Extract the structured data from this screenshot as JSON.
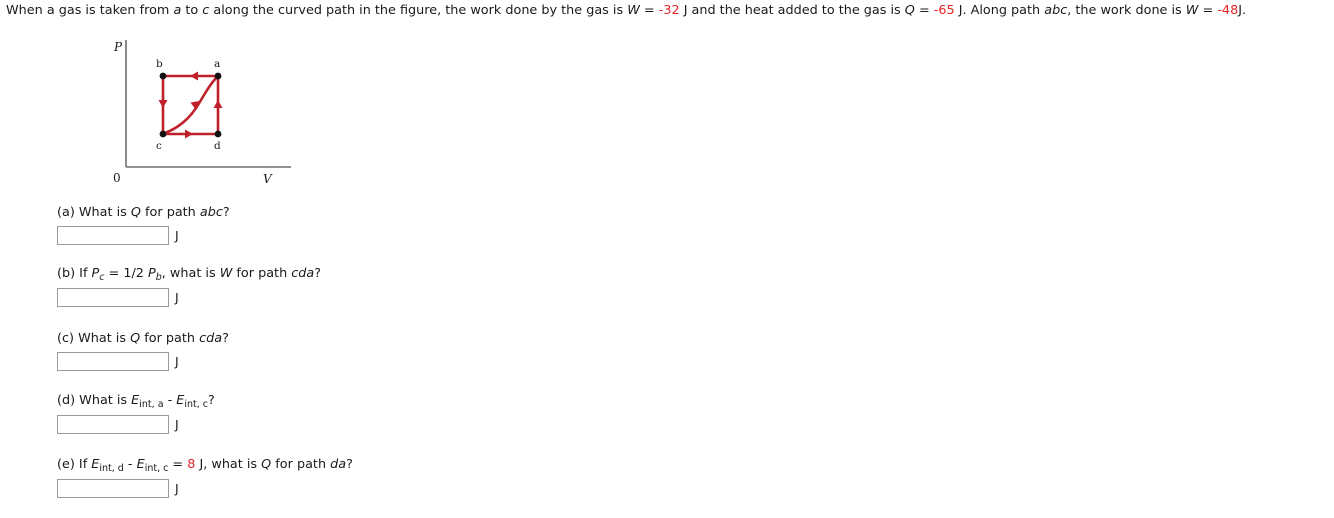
{
  "problem": {
    "text_parts": [
      {
        "t": "When a gas is taken from ",
        "style": "plain"
      },
      {
        "t": "a",
        "style": "italic"
      },
      {
        "t": " to ",
        "style": "plain"
      },
      {
        "t": "c",
        "style": "italic"
      },
      {
        "t": " along the curved path in the figure, the work done by the gas is ",
        "style": "plain"
      },
      {
        "t": "W",
        "style": "italic"
      },
      {
        "t": " = ",
        "style": "plain"
      },
      {
        "t": "-32",
        "style": "red"
      },
      {
        "t": " J and the heat added to the gas is ",
        "style": "plain"
      },
      {
        "t": "Q",
        "style": "italic"
      },
      {
        "t": " = ",
        "style": "plain"
      },
      {
        "t": "-65",
        "style": "red"
      },
      {
        "t": " J. Along path ",
        "style": "plain"
      },
      {
        "t": "abc",
        "style": "italic"
      },
      {
        "t": ", the work done is ",
        "style": "plain"
      },
      {
        "t": "W",
        "style": "italic"
      },
      {
        "t": " = ",
        "style": "plain"
      },
      {
        "t": "-48",
        "style": "red"
      },
      {
        "t": "J.",
        "style": "plain"
      }
    ],
    "work_ac": "-32",
    "heat_ac": "-65",
    "work_abc": "-48"
  },
  "figure": {
    "type": "pv-diagram",
    "y_axis_label": "P",
    "x_axis_label": "V",
    "origin_label": "0",
    "curve_color": "#c0202a",
    "axis_color": "#6e6e6e",
    "points": [
      {
        "label": "b",
        "position": "top-left"
      },
      {
        "label": "a",
        "position": "top-right"
      },
      {
        "label": "c",
        "position": "bottom-left"
      },
      {
        "label": "d",
        "position": "bottom-right"
      }
    ],
    "paths": [
      {
        "from": "a",
        "to": "b",
        "shape": "straight",
        "edge": "top",
        "arrow": "left"
      },
      {
        "from": "b",
        "to": "c",
        "shape": "straight",
        "edge": "left",
        "arrow": "down"
      },
      {
        "from": "c",
        "to": "d",
        "shape": "straight",
        "edge": "bottom",
        "arrow": "right"
      },
      {
        "from": "d",
        "to": "a",
        "shape": "straight",
        "edge": "right",
        "arrow": "up"
      },
      {
        "from": "a",
        "to": "c",
        "shape": "curved",
        "edge": "interior",
        "arrow": "down"
      }
    ]
  },
  "questions": {
    "a": {
      "label": "(a)",
      "prompt_before": " What is ",
      "symbol": "Q",
      "prompt_mid": " for path ",
      "path": "abc",
      "prompt_after": "?",
      "value": "",
      "placeholder": "",
      "unit": "J"
    },
    "b": {
      "label": "(b)",
      "prompt_before": " If ",
      "cond_sym1": "P",
      "cond_sub1": "c",
      "cond_eq": " = 1/2 ",
      "cond_sym2": "P",
      "cond_sub2": "b",
      "prompt_mid": ", what is ",
      "symbol": "W",
      "prompt_mid2": " for path ",
      "path": "cda",
      "prompt_after": "?",
      "value": "",
      "placeholder": "",
      "unit": "J"
    },
    "c": {
      "label": "(c)",
      "prompt_before": " What is ",
      "symbol": "Q",
      "prompt_mid": " for path ",
      "path": "cda",
      "prompt_after": "?",
      "value": "",
      "placeholder": "",
      "unit": "J"
    },
    "d": {
      "label": "(d)",
      "prompt_before": " What is ",
      "sym1": "E",
      "sub1": "int, a",
      "minus": " - ",
      "sym2": "E",
      "sub2": "int, c",
      "prompt_after": "?",
      "value": "",
      "placeholder": "",
      "unit": "J"
    },
    "e": {
      "label": "(e)",
      "prompt_before": " If ",
      "sym1": "E",
      "sub1": "int, d",
      "minus": " - ",
      "sym2": "E",
      "sub2": "int, c",
      "eq": " = ",
      "given_value": "8",
      "prompt_mid": " J, what is ",
      "symbol": "Q",
      "prompt_mid2": " for path ",
      "path": "da",
      "prompt_after": "?",
      "value": "",
      "placeholder": "",
      "unit": "J"
    }
  }
}
